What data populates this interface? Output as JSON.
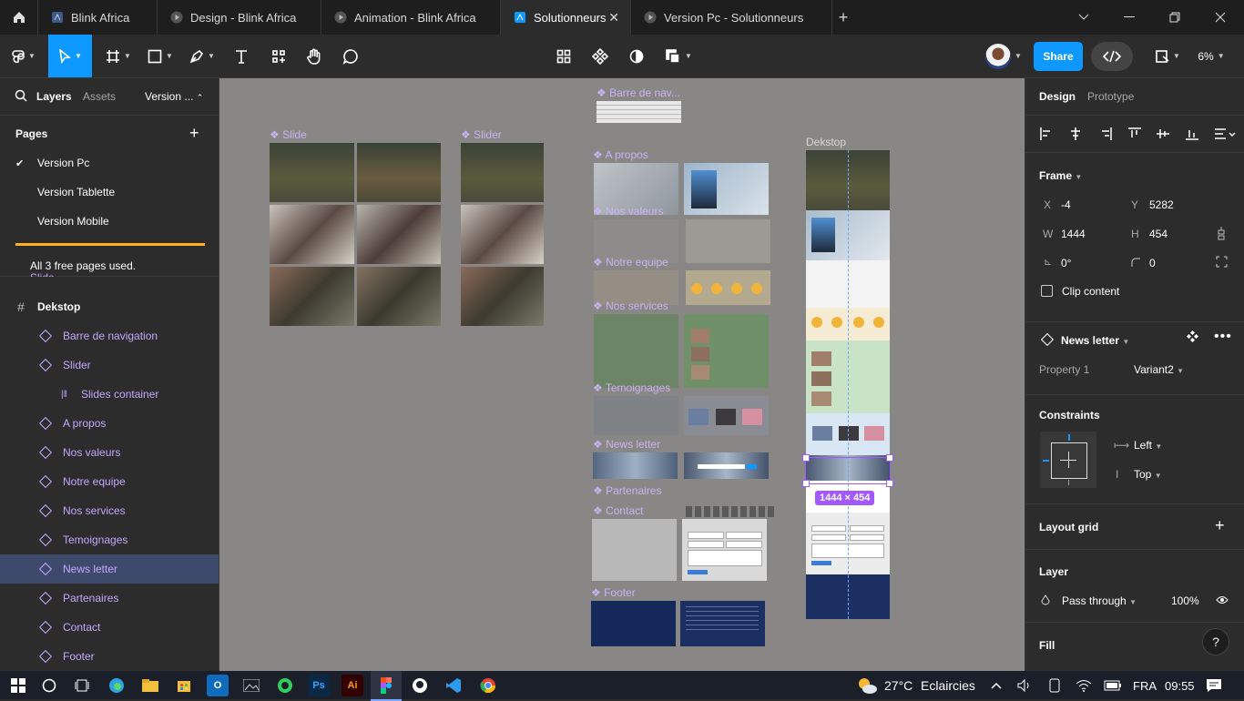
{
  "tabs": [
    {
      "label": "Blink Africa",
      "icon": "figma-file-icon",
      "active": false
    },
    {
      "label": "Design - Blink Africa",
      "icon": "play-icon",
      "active": false
    },
    {
      "label": "Animation - Blink Africa",
      "icon": "play-icon",
      "active": false
    },
    {
      "label": "Solutionneurs",
      "icon": "figma-file-icon",
      "active": true
    },
    {
      "label": "Version Pc - Solutionneurs",
      "icon": "play-icon",
      "active": false
    }
  ],
  "tab_close": "✕",
  "tab_add": "+",
  "toolbar": {
    "share_label": "Share",
    "zoom_label": "6%"
  },
  "left_panel": {
    "tab_layers": "Layers",
    "tab_assets": "Assets",
    "version_label": "Version ...",
    "pages_heading": "Pages",
    "pages": [
      "Version Pc",
      "Version Tablette",
      "Version Mobile"
    ],
    "free_pages_notice": "All 3 free pages used.",
    "hidden_row": "Slide",
    "frame_name": "Dekstop",
    "layers": [
      "Barre de navigation",
      "Slider",
      "Slides container",
      "A propos",
      "Nos valeurs",
      "Notre equipe",
      "Nos services",
      "Temoignages",
      "News letter",
      "Partenaires",
      "Contact",
      "Footer"
    ]
  },
  "canvas": {
    "labels": {
      "slide": "Slide",
      "slider": "Slider",
      "barre": "Barre de nav...",
      "apropos": "A propos",
      "valeurs": "Nos valeurs",
      "equipe": "Notre equipe",
      "services": "Nos services",
      "temoignages": "Temoignages",
      "newsletter": "News letter",
      "partenaires": "Partenaires",
      "contact": "Contact",
      "footer": "Footer",
      "dekstop": "Dekstop"
    },
    "size_badge": "1444 × 454"
  },
  "right_panel": {
    "tab_design": "Design",
    "tab_prototype": "Prototype",
    "frame_heading": "Frame",
    "x_label": "X",
    "x_value": "-4",
    "y_label": "Y",
    "y_value": "5282",
    "w_label": "W",
    "w_value": "1444",
    "h_label": "H",
    "h_value": "454",
    "rotation_value": "0°",
    "radius_value": "0",
    "clip_content": "Clip content",
    "component_name": "News letter",
    "property_label": "Property 1",
    "property_value": "Variant2",
    "constraints_heading": "Constraints",
    "constraint_h": "Left",
    "constraint_v": "Top",
    "layout_grid": "Layout grid",
    "layer_heading": "Layer",
    "blend_mode": "Pass through",
    "opacity": "100%",
    "fill_heading": "Fill",
    "help": "?"
  },
  "taskbar": {
    "weather_temp": "27°C",
    "weather_text": "Eclaircies",
    "language": "FRA",
    "time": "09:55"
  },
  "colors": {
    "accent_blue": "#0d99ff",
    "selection_purple": "#a259ff",
    "component_purple": "#c7a6ff",
    "canvas_gray": "#898786"
  }
}
